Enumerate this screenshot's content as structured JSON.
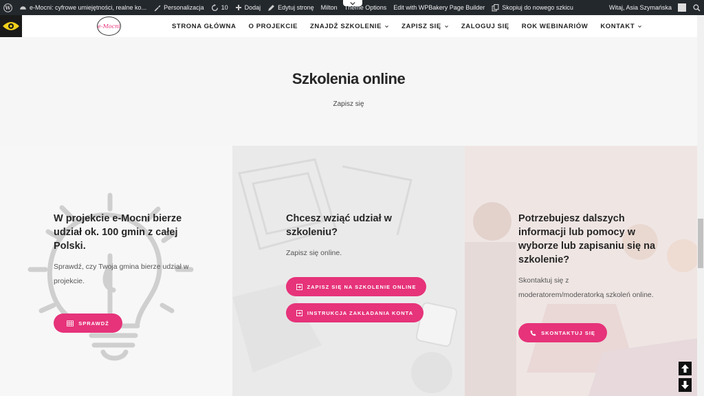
{
  "adminbar": {
    "site_name": "e-Mocni: cyfrowe umiejętności, realne ko...",
    "customize": "Personalizacja",
    "updates_count": "10",
    "new": "Dodaj",
    "edit_page": "Edytuj stronę",
    "milton": "Milton",
    "theme_options": "Theme Options",
    "wpbakery": "Edit with WPBakery Page Builder",
    "copy_draft": "Skopiuj do nowego szkicu",
    "greeting": "Witaj, Asia Szymańska"
  },
  "header": {
    "logo_text": "e-Mocni",
    "nav": [
      {
        "label": "STRONA GŁÓWNA"
      },
      {
        "label": "O PROJEKCIE"
      },
      {
        "label": "ZNAJDŹ SZKOLENIE"
      },
      {
        "label": "ZAPISZ SIĘ"
      },
      {
        "label": "ZALOGUJ SIĘ"
      },
      {
        "label": "ROK WEBINARIÓW"
      },
      {
        "label": "KONTAKT"
      }
    ]
  },
  "hero": {
    "title": "Szkolenia online",
    "subtitle": "Zapisz się"
  },
  "columns": [
    {
      "title": "W projekcie e-Mocni bierze udział ok. 100 gmin z całej Polski.",
      "text": "Sprawdź, czy Twoja gmina bierze udział w projekcie.",
      "buttons": [
        {
          "label": "SPRAWDŹ",
          "icon": "table-icon"
        }
      ]
    },
    {
      "title": "Chcesz wziąć udział w szkoleniu?",
      "text": "Zapisz się online.",
      "buttons": [
        {
          "label": "ZAPISZ SIĘ NA SZKOLENIE ONLINE",
          "icon": "sign-in-icon"
        },
        {
          "label": "INSTRUKCJA ZAKŁADANIA KONTA",
          "icon": "sign-in-icon"
        }
      ]
    },
    {
      "title": "Potrzebujesz dalszych informacji lub pomocy w wyborze lub zapisaniu się na szkolenie?",
      "text": "Skontaktuj się z moderatorem/moderatorką szkoleń online.",
      "buttons": [
        {
          "label": "SKONTAKTUJ SIĘ",
          "icon": "phone-icon"
        }
      ]
    }
  ],
  "colors": {
    "accent": "#e6337a",
    "adminbar": "#23282d"
  }
}
